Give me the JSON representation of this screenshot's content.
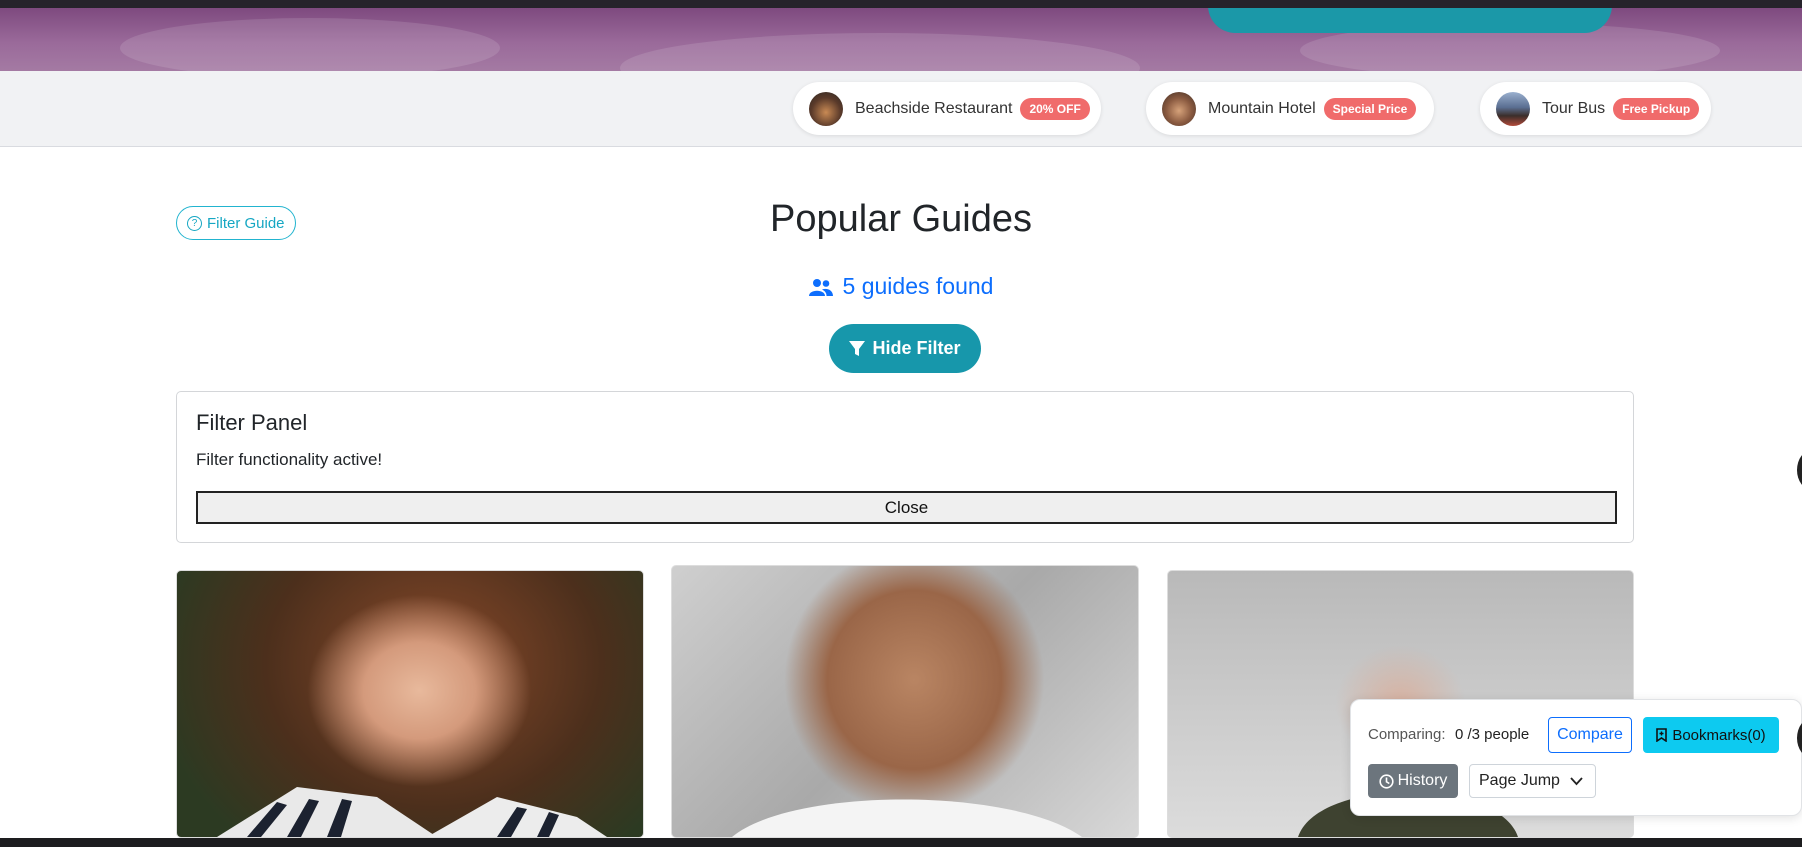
{
  "promos": [
    {
      "name": "Beachside Restaurant",
      "tag": "20% OFF"
    },
    {
      "name": "Mountain Hotel",
      "tag": "Special Price"
    },
    {
      "name": "Tour Bus",
      "tag": "Free Pickup"
    }
  ],
  "filter_guide": {
    "label": "Filter Guide"
  },
  "header": {
    "title": "Popular Guides",
    "found_text": "5 guides found",
    "hide_filter_label": "Hide Filter"
  },
  "filter_panel": {
    "title": "Filter Panel",
    "message": "Filter functionality active!",
    "close_label": "Close"
  },
  "compare_bar": {
    "label": "Comparing:",
    "count": "0 /3 people",
    "compare_label": "Compare",
    "bookmarks_label": "Bookmarks(0)",
    "history_label": "History",
    "page_jump_label": "Page Jump"
  },
  "colors": {
    "accent_teal": "#1797ab",
    "link_blue": "#0d6efd",
    "promo_tag": "#f06b6b",
    "bookmark_cyan": "#0dcaf0"
  }
}
